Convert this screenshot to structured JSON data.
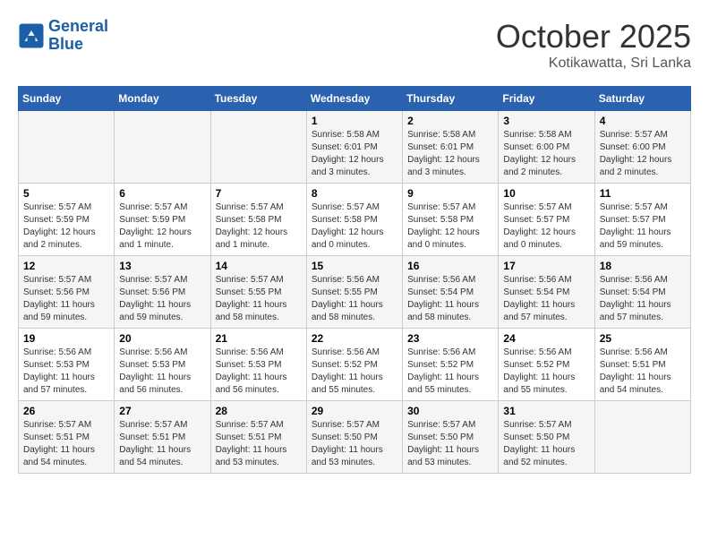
{
  "header": {
    "logo_line1": "General",
    "logo_line2": "Blue",
    "month": "October 2025",
    "location": "Kotikawatta, Sri Lanka"
  },
  "weekdays": [
    "Sunday",
    "Monday",
    "Tuesday",
    "Wednesday",
    "Thursday",
    "Friday",
    "Saturday"
  ],
  "weeks": [
    [
      {
        "day": "",
        "sunrise": "",
        "sunset": "",
        "daylight": ""
      },
      {
        "day": "",
        "sunrise": "",
        "sunset": "",
        "daylight": ""
      },
      {
        "day": "",
        "sunrise": "",
        "sunset": "",
        "daylight": ""
      },
      {
        "day": "1",
        "sunrise": "Sunrise: 5:58 AM",
        "sunset": "Sunset: 6:01 PM",
        "daylight": "Daylight: 12 hours and 3 minutes."
      },
      {
        "day": "2",
        "sunrise": "Sunrise: 5:58 AM",
        "sunset": "Sunset: 6:01 PM",
        "daylight": "Daylight: 12 hours and 3 minutes."
      },
      {
        "day": "3",
        "sunrise": "Sunrise: 5:58 AM",
        "sunset": "Sunset: 6:00 PM",
        "daylight": "Daylight: 12 hours and 2 minutes."
      },
      {
        "day": "4",
        "sunrise": "Sunrise: 5:57 AM",
        "sunset": "Sunset: 6:00 PM",
        "daylight": "Daylight: 12 hours and 2 minutes."
      }
    ],
    [
      {
        "day": "5",
        "sunrise": "Sunrise: 5:57 AM",
        "sunset": "Sunset: 5:59 PM",
        "daylight": "Daylight: 12 hours and 2 minutes."
      },
      {
        "day": "6",
        "sunrise": "Sunrise: 5:57 AM",
        "sunset": "Sunset: 5:59 PM",
        "daylight": "Daylight: 12 hours and 1 minute."
      },
      {
        "day": "7",
        "sunrise": "Sunrise: 5:57 AM",
        "sunset": "Sunset: 5:58 PM",
        "daylight": "Daylight: 12 hours and 1 minute."
      },
      {
        "day": "8",
        "sunrise": "Sunrise: 5:57 AM",
        "sunset": "Sunset: 5:58 PM",
        "daylight": "Daylight: 12 hours and 0 minutes."
      },
      {
        "day": "9",
        "sunrise": "Sunrise: 5:57 AM",
        "sunset": "Sunset: 5:58 PM",
        "daylight": "Daylight: 12 hours and 0 minutes."
      },
      {
        "day": "10",
        "sunrise": "Sunrise: 5:57 AM",
        "sunset": "Sunset: 5:57 PM",
        "daylight": "Daylight: 12 hours and 0 minutes."
      },
      {
        "day": "11",
        "sunrise": "Sunrise: 5:57 AM",
        "sunset": "Sunset: 5:57 PM",
        "daylight": "Daylight: 11 hours and 59 minutes."
      }
    ],
    [
      {
        "day": "12",
        "sunrise": "Sunrise: 5:57 AM",
        "sunset": "Sunset: 5:56 PM",
        "daylight": "Daylight: 11 hours and 59 minutes."
      },
      {
        "day": "13",
        "sunrise": "Sunrise: 5:57 AM",
        "sunset": "Sunset: 5:56 PM",
        "daylight": "Daylight: 11 hours and 59 minutes."
      },
      {
        "day": "14",
        "sunrise": "Sunrise: 5:57 AM",
        "sunset": "Sunset: 5:55 PM",
        "daylight": "Daylight: 11 hours and 58 minutes."
      },
      {
        "day": "15",
        "sunrise": "Sunrise: 5:56 AM",
        "sunset": "Sunset: 5:55 PM",
        "daylight": "Daylight: 11 hours and 58 minutes."
      },
      {
        "day": "16",
        "sunrise": "Sunrise: 5:56 AM",
        "sunset": "Sunset: 5:54 PM",
        "daylight": "Daylight: 11 hours and 58 minutes."
      },
      {
        "day": "17",
        "sunrise": "Sunrise: 5:56 AM",
        "sunset": "Sunset: 5:54 PM",
        "daylight": "Daylight: 11 hours and 57 minutes."
      },
      {
        "day": "18",
        "sunrise": "Sunrise: 5:56 AM",
        "sunset": "Sunset: 5:54 PM",
        "daylight": "Daylight: 11 hours and 57 minutes."
      }
    ],
    [
      {
        "day": "19",
        "sunrise": "Sunrise: 5:56 AM",
        "sunset": "Sunset: 5:53 PM",
        "daylight": "Daylight: 11 hours and 57 minutes."
      },
      {
        "day": "20",
        "sunrise": "Sunrise: 5:56 AM",
        "sunset": "Sunset: 5:53 PM",
        "daylight": "Daylight: 11 hours and 56 minutes."
      },
      {
        "day": "21",
        "sunrise": "Sunrise: 5:56 AM",
        "sunset": "Sunset: 5:53 PM",
        "daylight": "Daylight: 11 hours and 56 minutes."
      },
      {
        "day": "22",
        "sunrise": "Sunrise: 5:56 AM",
        "sunset": "Sunset: 5:52 PM",
        "daylight": "Daylight: 11 hours and 55 minutes."
      },
      {
        "day": "23",
        "sunrise": "Sunrise: 5:56 AM",
        "sunset": "Sunset: 5:52 PM",
        "daylight": "Daylight: 11 hours and 55 minutes."
      },
      {
        "day": "24",
        "sunrise": "Sunrise: 5:56 AM",
        "sunset": "Sunset: 5:52 PM",
        "daylight": "Daylight: 11 hours and 55 minutes."
      },
      {
        "day": "25",
        "sunrise": "Sunrise: 5:56 AM",
        "sunset": "Sunset: 5:51 PM",
        "daylight": "Daylight: 11 hours and 54 minutes."
      }
    ],
    [
      {
        "day": "26",
        "sunrise": "Sunrise: 5:57 AM",
        "sunset": "Sunset: 5:51 PM",
        "daylight": "Daylight: 11 hours and 54 minutes."
      },
      {
        "day": "27",
        "sunrise": "Sunrise: 5:57 AM",
        "sunset": "Sunset: 5:51 PM",
        "daylight": "Daylight: 11 hours and 54 minutes."
      },
      {
        "day": "28",
        "sunrise": "Sunrise: 5:57 AM",
        "sunset": "Sunset: 5:51 PM",
        "daylight": "Daylight: 11 hours and 53 minutes."
      },
      {
        "day": "29",
        "sunrise": "Sunrise: 5:57 AM",
        "sunset": "Sunset: 5:50 PM",
        "daylight": "Daylight: 11 hours and 53 minutes."
      },
      {
        "day": "30",
        "sunrise": "Sunrise: 5:57 AM",
        "sunset": "Sunset: 5:50 PM",
        "daylight": "Daylight: 11 hours and 53 minutes."
      },
      {
        "day": "31",
        "sunrise": "Sunrise: 5:57 AM",
        "sunset": "Sunset: 5:50 PM",
        "daylight": "Daylight: 11 hours and 52 minutes."
      },
      {
        "day": "",
        "sunrise": "",
        "sunset": "",
        "daylight": ""
      }
    ]
  ]
}
